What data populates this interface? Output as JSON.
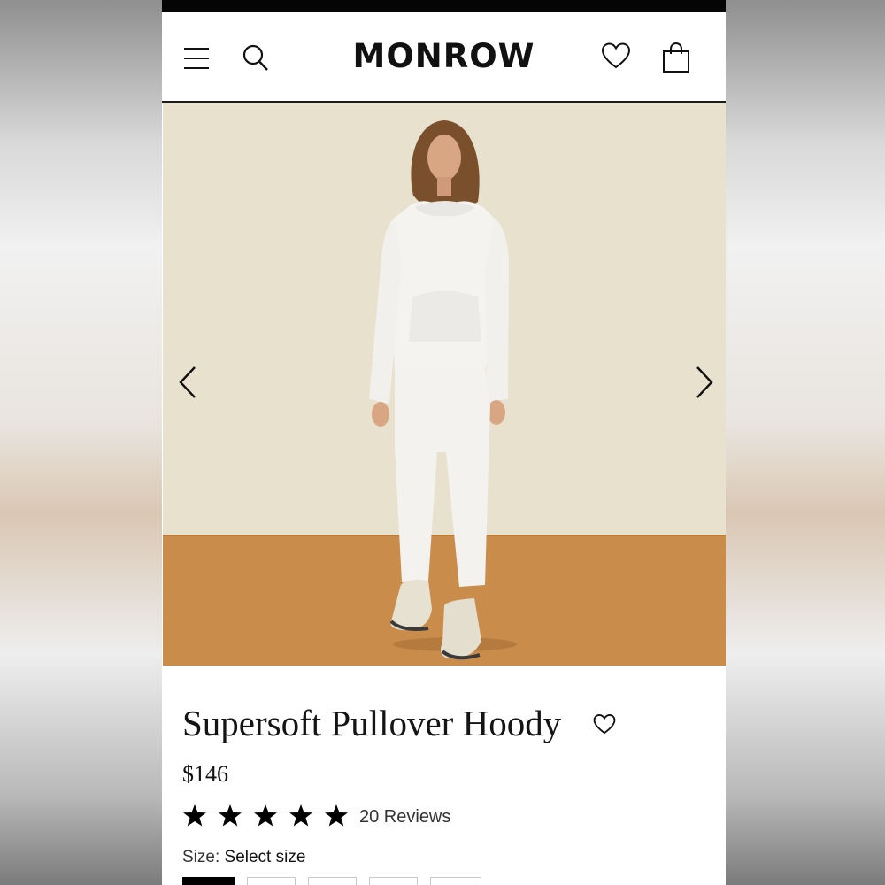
{
  "header": {
    "logo": "MONROW",
    "icons": [
      "menu-icon",
      "search-icon",
      "heart-icon",
      "shopping-bag-icon"
    ]
  },
  "gallery": {
    "image_description_icon": "product-photo",
    "prev_icon": "chevron-left-icon",
    "next_icon": "chevron-right-icon"
  },
  "product": {
    "title": "Supersoft Pullover Hoody",
    "price": "$146",
    "rating": 5,
    "reviews_label": "20 Reviews",
    "size_label": "Size:",
    "size_value": "Select size"
  },
  "sizes": {
    "count_visible": 5,
    "selected_index": 0
  },
  "colors": {
    "topbar": "#050505",
    "backdrop_wall": "#e7e1cd",
    "backdrop_floor": "#c98c4b",
    "text": "#141414"
  }
}
